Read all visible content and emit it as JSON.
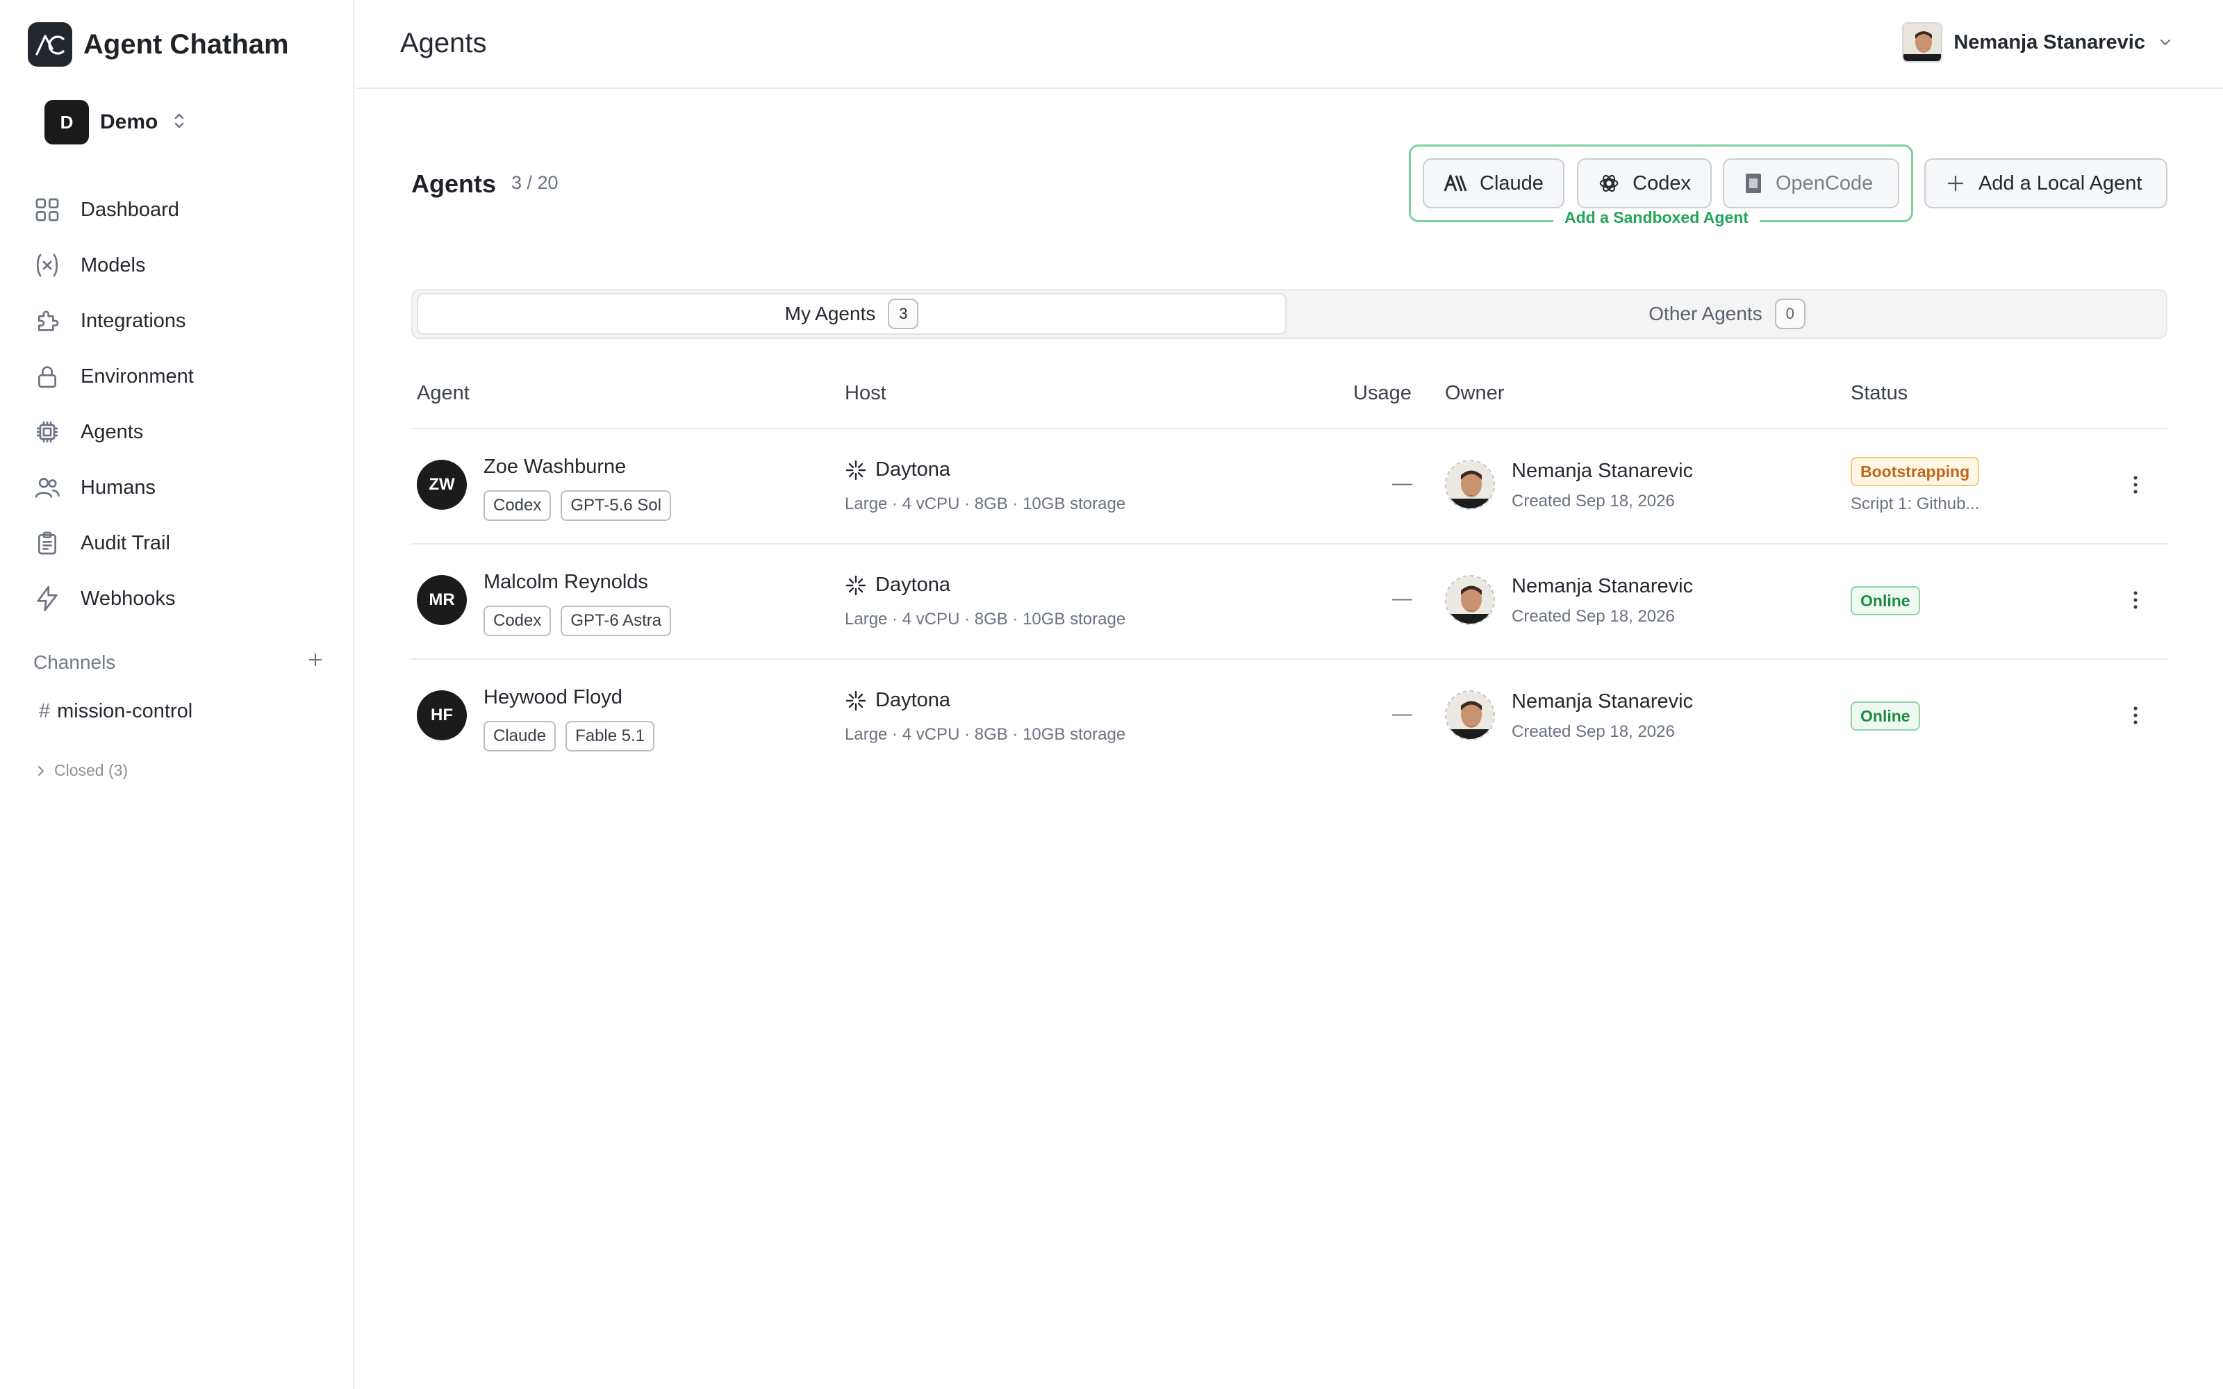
{
  "brand": {
    "name": "Agent Chatham"
  },
  "org": {
    "badge": "D",
    "name": "Demo"
  },
  "nav": [
    {
      "label": "Dashboard",
      "icon": "grid-icon"
    },
    {
      "label": "Models",
      "icon": "function-icon"
    },
    {
      "label": "Integrations",
      "icon": "puzzle-icon"
    },
    {
      "label": "Environment",
      "icon": "lock-icon"
    },
    {
      "label": "Agents",
      "icon": "chip-icon"
    },
    {
      "label": "Humans",
      "icon": "users-icon"
    },
    {
      "label": "Audit Trail",
      "icon": "clipboard-icon"
    },
    {
      "label": "Webhooks",
      "icon": "bolt-icon"
    }
  ],
  "channels": {
    "heading": "Channels",
    "items": [
      "mission-control"
    ],
    "closed_label": "Closed (3)"
  },
  "header": {
    "title": "Agents",
    "user_name": "Nemanja Stanarevic"
  },
  "main": {
    "title": "Agents",
    "count": "3 / 20",
    "sandbox_label": "Add a Sandboxed Agent",
    "buttons": {
      "claude": "Claude",
      "codex": "Codex",
      "opencode": "OpenCode",
      "local": "Add a Local Agent"
    },
    "tabs": [
      {
        "label": "My Agents",
        "count": "3"
      },
      {
        "label": "Other Agents",
        "count": "0"
      }
    ],
    "columns": {
      "agent": "Agent",
      "host": "Host",
      "usage": "Usage",
      "owner": "Owner",
      "status": "Status"
    },
    "rows": [
      {
        "initials": "ZW",
        "name": "Zoe Washburne",
        "tags": [
          "Codex",
          "GPT-5.6 Sol"
        ],
        "host": "Daytona",
        "spec": "Large · 4 vCPU · 8GB · 10GB storage",
        "usage": "—",
        "owner": "Nemanja Stanarevic",
        "created": "Created Sep 18, 2026",
        "status": "Bootstrapping",
        "status_sub": "Script 1: Github..."
      },
      {
        "initials": "MR",
        "name": "Malcolm Reynolds",
        "tags": [
          "Codex",
          "GPT-6 Astra"
        ],
        "host": "Daytona",
        "spec": "Large · 4 vCPU · 8GB · 10GB storage",
        "usage": "—",
        "owner": "Nemanja Stanarevic",
        "created": "Created Sep 18, 2026",
        "status": "Online",
        "status_sub": ""
      },
      {
        "initials": "HF",
        "name": "Heywood Floyd",
        "tags": [
          "Claude",
          "Fable 5.1"
        ],
        "host": "Daytona",
        "spec": "Large · 4 vCPU · 8GB · 10GB storage",
        "usage": "—",
        "owner": "Nemanja Stanarevic",
        "created": "Created Sep 18, 2026",
        "status": "Online",
        "status_sub": ""
      }
    ]
  },
  "colors": {
    "sandbox_green": "#23a55a",
    "bootstrapping": "#c0661a",
    "online": "#1f8a43"
  }
}
